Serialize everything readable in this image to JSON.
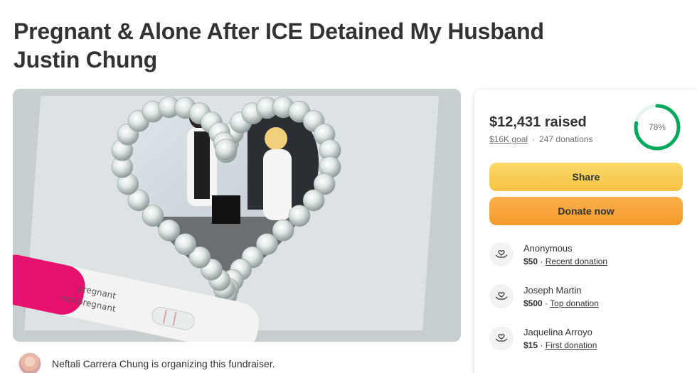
{
  "campaign": {
    "title_line1": "Pregnant & Alone After ICE Detained My Husband",
    "title_line2": "Justin Chung"
  },
  "hero_image": {
    "test_label_pregnant": "pregnant",
    "test_label_not_pregnant": "not pregnant"
  },
  "organizer": {
    "text": "Neftali Carrera Chung is organizing this fundraiser."
  },
  "donation_card": {
    "raised": "$12,431 raised",
    "goal": "$16K goal",
    "separator": "·",
    "donations": "247 donations",
    "progress_label": "78%",
    "progress_fraction": 0.78,
    "progress_color": "#02a95c",
    "share_label": "Share",
    "donate_label": "Donate now",
    "recent": [
      {
        "name": "Anonymous",
        "amount": "$50",
        "sep": " · ",
        "tag": "Recent donation"
      },
      {
        "name": "Joseph Martin",
        "amount": "$500",
        "sep": " · ",
        "tag": "Top donation"
      },
      {
        "name": "Jaquelina Arroyo",
        "amount": "$15",
        "sep": " · ",
        "tag": "First donation"
      }
    ]
  }
}
